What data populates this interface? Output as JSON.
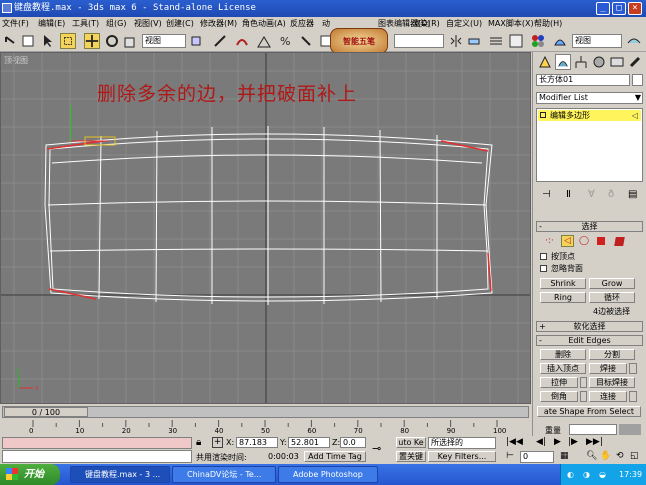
{
  "window": {
    "title": "键盘教程.max - 3ds max 6 - Stand-alone License"
  },
  "menu": {
    "items": [
      "文件(F)",
      "编辑(E)",
      "工具(T)",
      "组(G)",
      "视图(V)",
      "创建(C)",
      "修改器(M)",
      "角色动画(A)",
      "反应器",
      "动画(N)",
      "图表编辑器(D)",
      "渲染(R)",
      "自定义(U)",
      "MAX脚本(X)",
      "帮助(H)"
    ]
  },
  "toolbar": {
    "view_select": "视图",
    "named_selection": "",
    "view_select2": "视图",
    "logo_text": "智能五笔"
  },
  "viewport": {
    "label": "顶视图",
    "annotation": "删除多余的边，并把破面补上"
  },
  "command_panel": {
    "object_name": "长方体01",
    "modifier_list": "Modifier List",
    "stack_item": "编辑多边形",
    "selection_rollout": "选择",
    "by_vertex": "按顶点",
    "ignore_backfacing": "忽略背面",
    "shrink": "Shrink",
    "grow": "Grow",
    "ring": "Ring",
    "loop": "循环",
    "selection_info": "4边被选择",
    "soft_selection": "软化选择",
    "edit_edges": "Edit Edges",
    "remove": "删除",
    "split": "分割",
    "insert_vertex": "插入顶点",
    "weld": "焊接",
    "extrude": "拉伸",
    "target_weld": "目标焊接",
    "chamfer": "倒角",
    "connect": "连接",
    "create_shape": "ate Shape From Select",
    "weight": "重量"
  },
  "timeline": {
    "frame_display": "0 / 100",
    "ticks": [
      "0",
      "10",
      "20",
      "30",
      "40",
      "50",
      "60",
      "70",
      "80",
      "90",
      "100"
    ]
  },
  "status": {
    "x_label": "X:",
    "x": "87.183",
    "y_label": "Y:",
    "y": "52.801",
    "z_label": "Z:",
    "z": "0.0",
    "auto_key": "uto Ke",
    "selected": "所选择的",
    "set_key": "置关键",
    "key_filters": "Key Filters...",
    "prompt": "共用渲染时间:",
    "time": "0:00:03",
    "add_time_tag": "Add Time Tag",
    "frame": "0"
  },
  "taskbar": {
    "start": "开始",
    "tasks": [
      "键盘教程.max - 3 ...",
      "ChinaDV论坛 - Te...",
      "Adobe Photoshop"
    ],
    "clock": "17:39"
  },
  "colors": {
    "viewport_bg": "#7a7a7a",
    "grid": "#8c8c8c",
    "axis": "#3a3a3a",
    "wire": "#ffffff",
    "selected_edge": "#e03030",
    "annotation": "#b01818"
  }
}
